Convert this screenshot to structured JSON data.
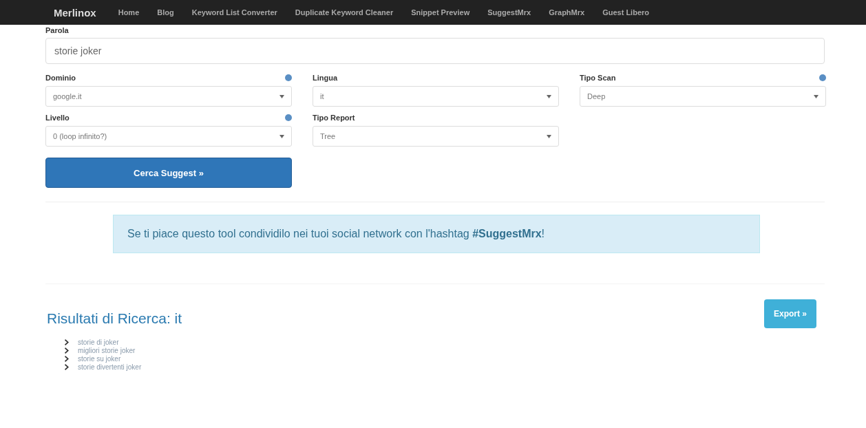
{
  "navbar": {
    "brand": "Merlinox",
    "links": [
      "Home",
      "Blog",
      "Keyword List Converter",
      "Duplicate Keyword Cleaner",
      "Snippet Preview",
      "SuggestMrx",
      "GraphMrx",
      "Guest Libero"
    ]
  },
  "query": {
    "label": "Parola",
    "value": "storie joker"
  },
  "fields": [
    {
      "label": "Dominio",
      "value": "google.it",
      "help": true
    },
    {
      "label": "Lingua",
      "value": "it",
      "help": false
    },
    {
      "label": "Tipo Scan",
      "value": "Deep",
      "help": true
    },
    {
      "label": "Livello",
      "value": "0 (loop infinito?)",
      "help": true
    },
    {
      "label": "Tipo Report",
      "value": "Tree",
      "help": false
    }
  ],
  "search_button": "Cerca Suggest »",
  "notice": "Se ti piace questo tool condividilo nei tuoi social network con l'hashtag **#SuggestMrx**!",
  "results": {
    "title": "Risultati di Ricerca: it",
    "export_button": "Export »",
    "items": [
      "storie di joker",
      "migliori storie joker",
      "storie su joker",
      "storie divertenti joker"
    ]
  }
}
